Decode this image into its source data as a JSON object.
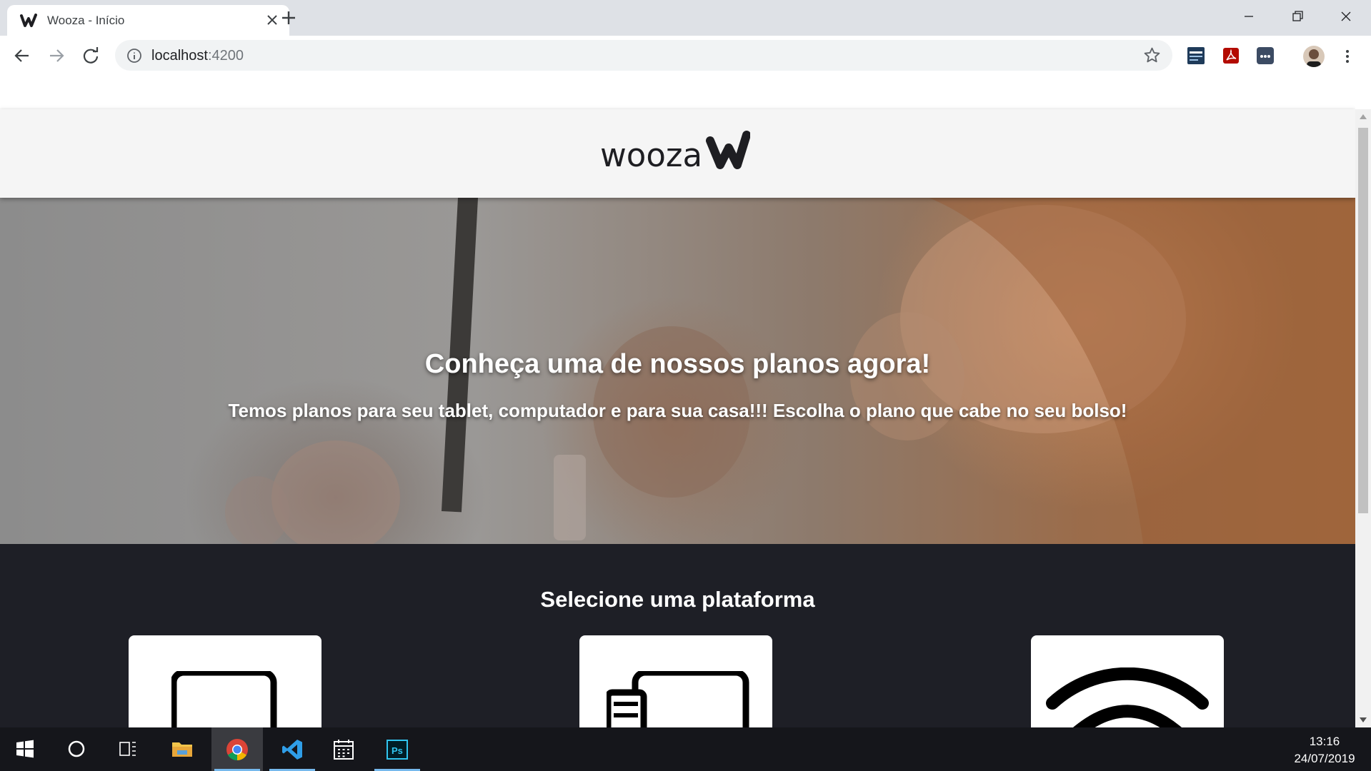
{
  "browser": {
    "tab_title": "Wooza - Início",
    "url_host": "localhost",
    "url_port": ":4200"
  },
  "site": {
    "logo_text": "wooza",
    "hero": {
      "title": "Conheça uma de nossos planos agora!",
      "subtitle": "Temos planos para seu tablet, computador e para sua casa!!! Escolha o plano que cabe no seu bolso!"
    },
    "platforms": {
      "title": "Selecione uma plataforma",
      "cards": [
        {
          "icon": "tablet-icon"
        },
        {
          "icon": "computer-icon"
        },
        {
          "icon": "wifi-icon"
        }
      ]
    }
  },
  "taskbar": {
    "time": "13:16",
    "date": "24/07/2019"
  },
  "colors": {
    "tabstrip": "#dee1e6",
    "header": "#f5f5f5",
    "platforms_bg": "#1e1f26",
    "taskbar": "#15161b"
  }
}
